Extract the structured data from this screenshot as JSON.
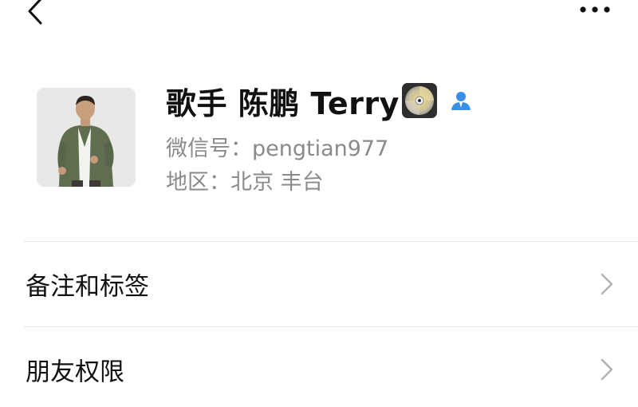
{
  "profile": {
    "name": "歌手 陈鹏 Terry",
    "wechat_id": "微信号：pengtian977",
    "region": "地区：北京 丰台"
  },
  "menu": {
    "items": [
      {
        "label": "备注和标签"
      },
      {
        "label": "朋友权限"
      }
    ]
  },
  "icons": {
    "back": "back-arrow-icon",
    "more": "more-dots-icon",
    "disc": "cd-disc-icon",
    "contact": "contact-person-icon",
    "chevron": "chevron-right-icon"
  },
  "colors": {
    "secondary_text": "#8a8a8a",
    "contact_icon": "#3a8ee6",
    "divider": "#e6e6e6"
  }
}
